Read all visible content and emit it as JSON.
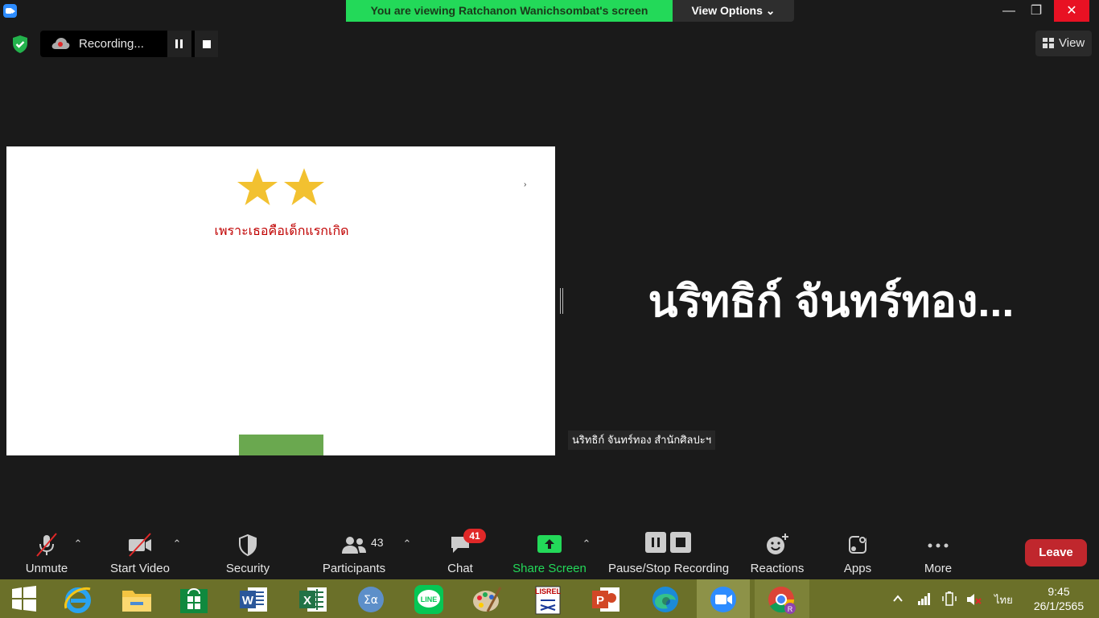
{
  "titlebar": {
    "banner_text": "You are viewing Ratchanon Wanichsombat's screen",
    "view_options_label": "View Options ⌄",
    "minimize": "—",
    "maximize": "❐",
    "close": "✕"
  },
  "recording": {
    "label": "Recording..."
  },
  "view_button": {
    "label": "View"
  },
  "slide": {
    "subtitle": "เพราะเธอคือเด็กแรกเกิด",
    "stars": 2
  },
  "participant": {
    "display_name": "นริทธิก์ จันทร์ทอง...",
    "name_tag": "นริทธิก์ จันทร์ทอง สำนักศิลปะฯ"
  },
  "controls": {
    "unmute": "Unmute",
    "start_video": "Start Video",
    "security": "Security",
    "participants": "Participants",
    "participants_count": "43",
    "chat": "Chat",
    "chat_badge": "41",
    "share_screen": "Share Screen",
    "pause_stop_recording": "Pause/Stop Recording",
    "reactions": "Reactions",
    "apps": "Apps",
    "more": "More",
    "leave": "Leave"
  },
  "colors": {
    "share_green": "#23d959",
    "leave_red": "#c0272d",
    "badge_red": "#e02828",
    "star_gold": "#f2c130",
    "taskbar": "#6b7029"
  },
  "taskbar": {
    "apps": [
      "start-icon",
      "internet-explorer-icon",
      "file-explorer-icon",
      "store-icon",
      "word-icon",
      "excel-icon",
      "math-input-icon",
      "line-icon",
      "paint-icon",
      "lisrel-icon",
      "powerpoint-icon",
      "edge-icon",
      "zoom-icon",
      "chrome-icon"
    ],
    "lisrel_label": "LISREL",
    "tray_lang": "ไทย",
    "time": "9:45",
    "date": "26/1/2565"
  }
}
